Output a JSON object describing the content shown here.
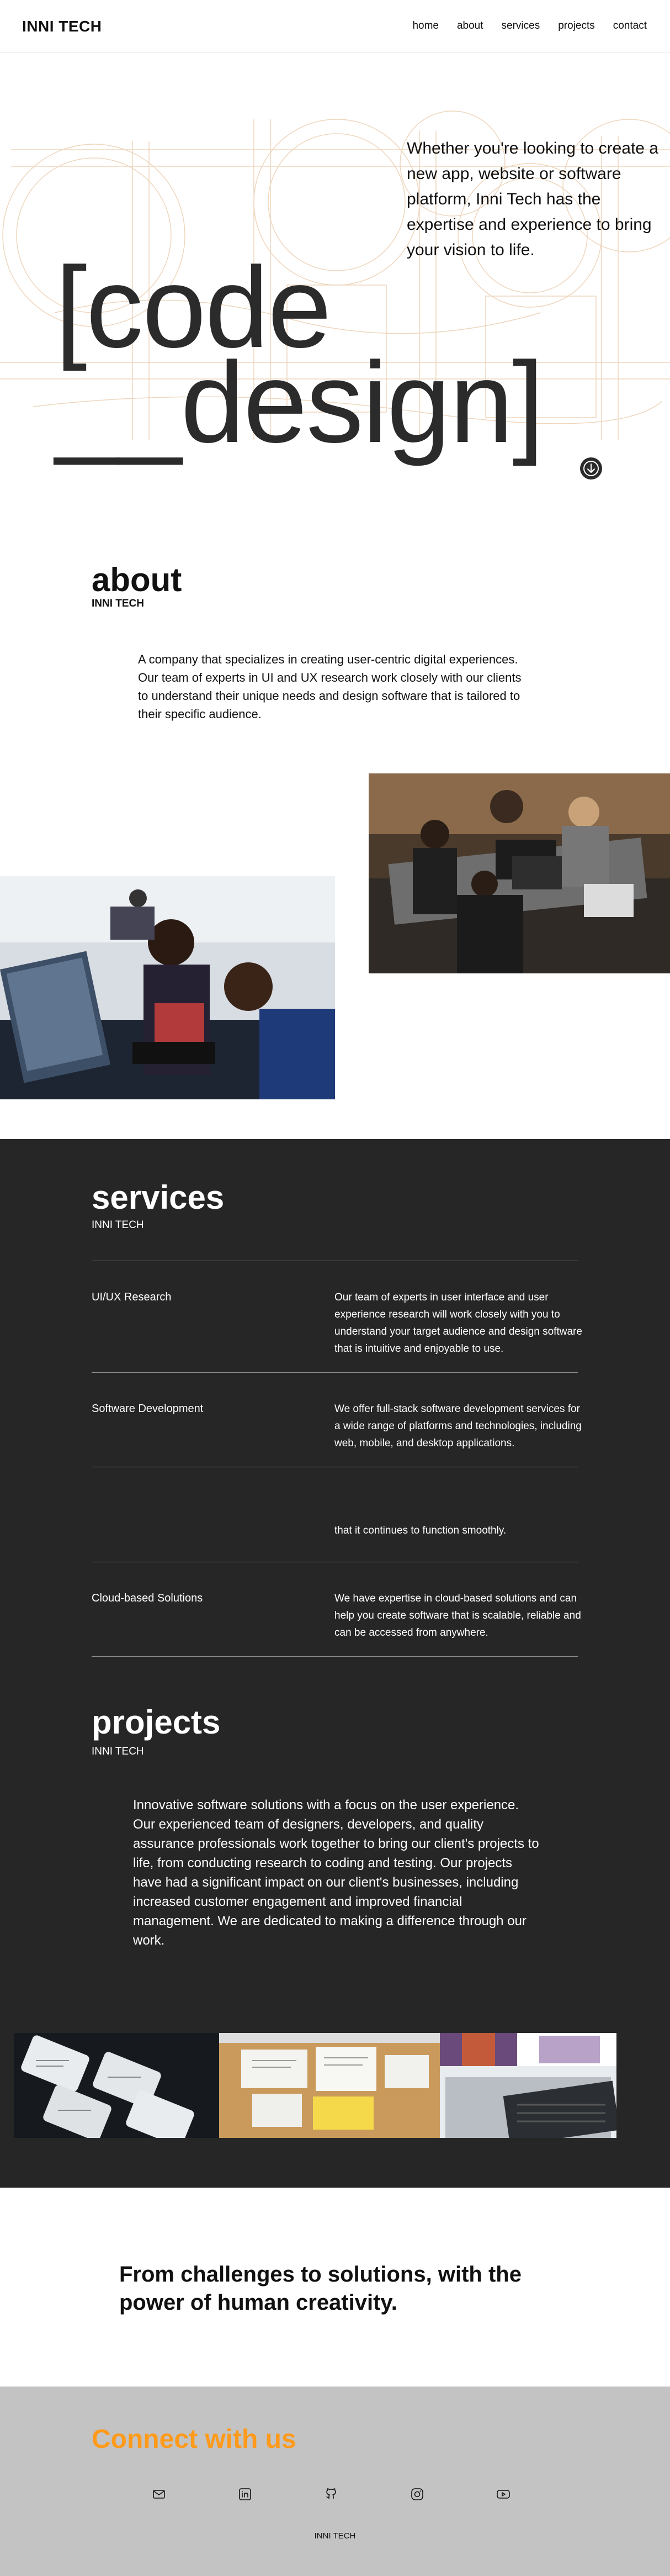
{
  "header": {
    "brand": "INNI TECH",
    "nav": [
      "home",
      "about",
      "services",
      "projects",
      "contact"
    ]
  },
  "hero": {
    "tagline": "Whether you're looking to create a new app, website or software platform, Inni Tech has the expertise and experience to bring your vision to life.",
    "title_line1": "[code",
    "title_line2": "__design]",
    "scroll_icon": "arrow-down-circle-icon"
  },
  "about": {
    "title": "about",
    "subtitle": "INNI TECH",
    "text": "A company that specializes in creating user-centric digital experiences. Our team of experts in UI and UX research work closely with our clients to understand their unique needs and design software that is tailored to their specific audience."
  },
  "services": {
    "title": "services",
    "subtitle": "INNI TECH",
    "items": [
      {
        "name": "UI/UX Research",
        "desc": "Our team of experts in user interface and user experience research will work closely with you to understand your target audience and design software that is intuitive and enjoyable to use."
      },
      {
        "name": "Software Development",
        "desc": "We offer full-stack software development services for a wide range of platforms and technologies, including web, mobile, and desktop applications."
      },
      {
        "name": "",
        "desc": "that it continues to function smoothly."
      },
      {
        "name": "Cloud-based Solutions",
        "desc": "We have expertise in cloud-based solutions and can help you create software that is scalable, reliable and can be accessed from anywhere."
      }
    ]
  },
  "projects": {
    "title": "projects",
    "subtitle": "INNI TECH",
    "text": "Innovative software solutions with a focus on the user experience. Our experienced team of designers, developers, and quality assurance professionals work together to bring our client's projects to life, from conducting research to coding and testing. Our projects have had a significant impact on our client's businesses, including increased customer engagement and improved financial management. We are dedicated to making a difference through our work."
  },
  "quote": "From challenges to solutions, with the power of human creativity.",
  "footer": {
    "title": "Connect with us",
    "socials": [
      "mail-icon",
      "linkedin-icon",
      "github-icon",
      "instagram-icon",
      "youtube-icon"
    ],
    "brand": "INNI TECH"
  },
  "colors": {
    "dark_bg": "#262626",
    "accent_orange": "#ff9a1a",
    "footer_bg": "#c3c3c3",
    "hero_line": "#e8c9a8"
  }
}
